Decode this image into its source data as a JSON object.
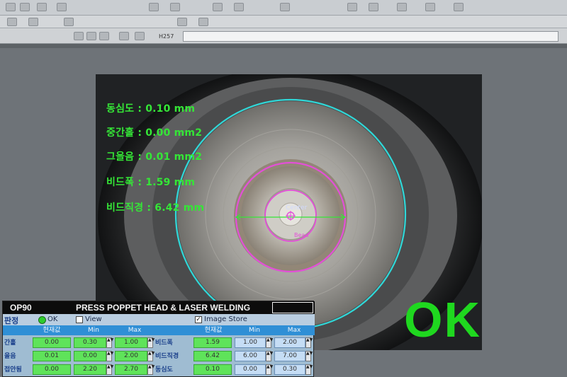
{
  "toolbar": {
    "cell_reference": "H257",
    "formula": ""
  },
  "measurements": [
    {
      "label": "동심도",
      "value": "0.10 mm"
    },
    {
      "label": "중간홀",
      "value": "0.00 mm2"
    },
    {
      "label": "그을음",
      "value": "0.01 mm2"
    },
    {
      "label": "비드폭",
      "value": "1.59 mm"
    },
    {
      "label": "비드직경",
      "value": "6.42 mm"
    }
  ],
  "overlay": {
    "center_label": "Center",
    "bead_label": "Bead"
  },
  "result": "OK",
  "colors": {
    "measurement_text": "#35e637",
    "outer_circle": "#30d8d8",
    "bead_circle": "#e34fd8",
    "ok_text": "#1fd81f"
  },
  "panel": {
    "op_code": "OP90",
    "title": "PRESS POPPET HEAD & LASER WELDING",
    "judgement_label": "판정",
    "ok_option": "OK",
    "view_label": "View",
    "image_store_label": "Image Store",
    "image_store_checked": "✓",
    "left_group": {
      "headers": {
        "current": "현재값",
        "min": "Min",
        "max": "Max"
      },
      "rows": [
        {
          "label": "간홀",
          "current": "0.00",
          "min": "0.30",
          "max": "1.00"
        },
        {
          "label": "을음",
          "current": "0.01",
          "min": "0.00",
          "max": "2.00"
        },
        {
          "label": "접안됨",
          "current": "0.00",
          "min": "2.20",
          "max": "2.70"
        }
      ]
    },
    "right_group": {
      "headers": {
        "current": "현재값",
        "min": "Min",
        "max": "Max"
      },
      "rows": [
        {
          "label": "비드폭",
          "current": "1.59",
          "min": "1.00",
          "max": "2.00"
        },
        {
          "label": "비드직경",
          "current": "6.42",
          "min": "6.00",
          "max": "7.00"
        },
        {
          "label": "동심도",
          "current": "0.10",
          "min": "0.00",
          "max": "0.30"
        }
      ]
    }
  }
}
